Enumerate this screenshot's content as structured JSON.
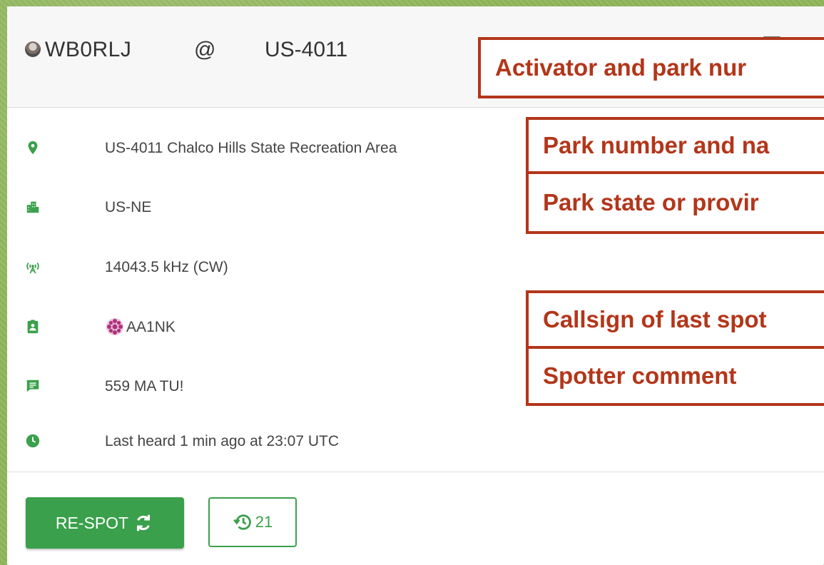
{
  "header": {
    "callsign": "WB0RLJ",
    "at": "@",
    "park_ref": "US-4011",
    "avatar": "operator-photo",
    "comment_icon": "comment-icon"
  },
  "details": [
    {
      "icon": "map-pin-icon",
      "text": "US-4011  Chalco Hills State Recreation Area"
    },
    {
      "icon": "city-icon",
      "text": "US-NE"
    },
    {
      "icon": "antenna-icon",
      "text": "14043.5 kHz (CW)"
    },
    {
      "icon": "badge-icon",
      "text": "AA1NK",
      "avatar": "spotter-avatar"
    },
    {
      "icon": "message-icon",
      "text": "559 MA TU!"
    },
    {
      "icon": "clock-icon",
      "text": "Last heard 1 min ago at 23:07 UTC"
    }
  ],
  "actions": {
    "respot_label": "RE-SPOT",
    "respot_icon": "refresh-icon",
    "history_count": "21",
    "history_icon": "history-icon"
  },
  "callouts": [
    "Activator and park nur",
    "Park number and na",
    "Park state or provir",
    "Callsign of last spot",
    "Spotter comment"
  ],
  "colors": {
    "accent": "#3aa04b",
    "callout": "#b3361a",
    "background": "#8fb65a"
  }
}
